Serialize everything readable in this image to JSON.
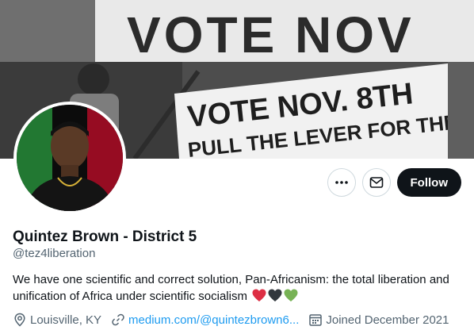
{
  "banner": {
    "sign_top_text": "VOTE NOV",
    "sign_main_line1": "VOTE NOV. 8TH",
    "sign_main_line2": "PULL THE LEVER FOR THE"
  },
  "actions": {
    "more_icon": "more-icon",
    "message_icon": "envelope-icon",
    "follow_label": "Follow"
  },
  "profile": {
    "name": "Quintez Brown - District 5",
    "handle": "@tez4liberation",
    "bio": "We have one scientific and correct solution, Pan-Africanism: the total liberation and unification of Africa under scientific socialism",
    "bio_emojis": [
      {
        "name": "red-heart-icon",
        "color": "#dd2e44"
      },
      {
        "name": "black-heart-icon",
        "color": "#31373d"
      },
      {
        "name": "green-heart-icon",
        "color": "#77b255"
      }
    ]
  },
  "meta": {
    "location": "Louisville, KY",
    "website": "medium.com/@quintezbrown6...",
    "joined": "Joined December 2021"
  },
  "colors": {
    "accent": "#1d9bf0",
    "follow_bg": "#0f1419",
    "secondary_text": "#536471",
    "border": "#cfd9de"
  }
}
